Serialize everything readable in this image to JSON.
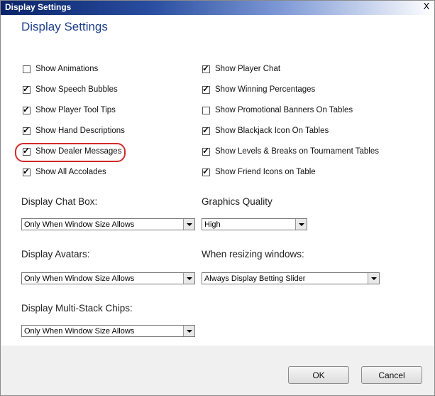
{
  "window": {
    "title": "Display Settings",
    "close_glyph": "X"
  },
  "heading": "Display Settings",
  "checkboxes_left": [
    {
      "label": "Show Animations",
      "checked": false
    },
    {
      "label": "Show Speech Bubbles",
      "checked": true
    },
    {
      "label": "Show Player Tool Tips",
      "checked": true
    },
    {
      "label": "Show Hand Descriptions",
      "checked": true
    },
    {
      "label": "Show Dealer Messages",
      "checked": true,
      "highlighted": true
    },
    {
      "label": "Show All Accolades",
      "checked": true
    }
  ],
  "checkboxes_right": [
    {
      "label": "Show Player Chat",
      "checked": true
    },
    {
      "label": "Show Winning Percentages",
      "checked": true
    },
    {
      "label": "Show Promotional Banners On Tables",
      "checked": false
    },
    {
      "label": "Show Blackjack Icon On Tables",
      "checked": true
    },
    {
      "label": "Show Levels & Breaks on Tournament Tables",
      "checked": true
    },
    {
      "label": "Show Friend Icons on Table",
      "checked": true
    }
  ],
  "selects": {
    "chat_box": {
      "label": "Display Chat Box:",
      "value": "Only When Window Size Allows"
    },
    "graphics": {
      "label": "Graphics Quality",
      "value": "High"
    },
    "avatars": {
      "label": "Display Avatars:",
      "value": "Only When Window Size Allows"
    },
    "resizing": {
      "label": "When resizing windows:",
      "value": "Always Display Betting Slider"
    },
    "chips": {
      "label": "Display Multi-Stack Chips:",
      "value": "Only When Window Size Allows"
    }
  },
  "buttons": {
    "ok": "OK",
    "cancel": "Cancel"
  },
  "colors": {
    "heading": "#1e3f8a",
    "highlight": "#d22a2a",
    "titlebar": "#0a246a"
  }
}
